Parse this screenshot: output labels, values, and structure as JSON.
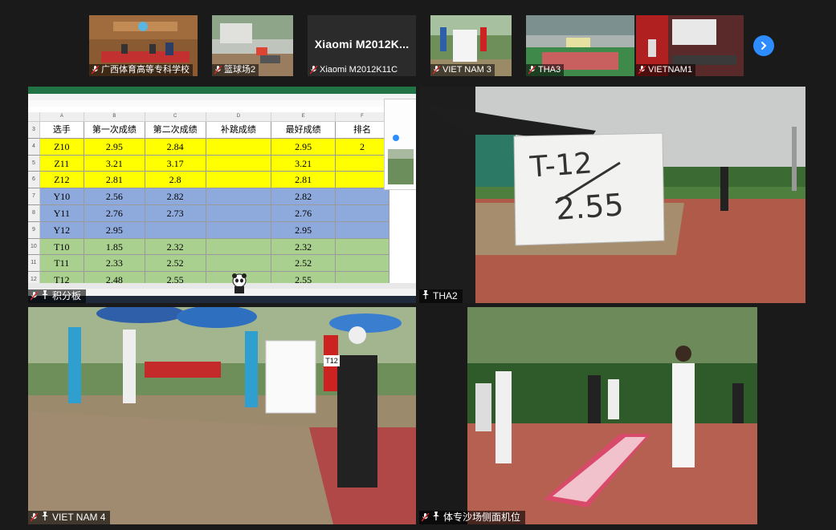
{
  "thumbnails": [
    {
      "label": "广西体育高等专科学校"
    },
    {
      "label": "篮球场2"
    },
    {
      "label": "Xiaomi M2012K11C",
      "name_card": "Xiaomi  M2012K..."
    },
    {
      "label": "VIET NAM 3"
    },
    {
      "label": "THA3"
    },
    {
      "label": "VIETNAM1"
    }
  ],
  "tiles": {
    "scoreboard": {
      "label": "积分板"
    },
    "tha2": {
      "label": "THA2",
      "sign_line1": "T-12",
      "sign_line2": "2.55"
    },
    "vietnam4": {
      "label": "VIET NAM 4",
      "bib": "T12"
    },
    "sandpit": {
      "label": "体专沙场侧面机位"
    }
  },
  "spreadsheet": {
    "col_letters": [
      "A",
      "B",
      "C",
      "D",
      "E",
      "F"
    ],
    "headers": [
      "选手",
      "第一次成绩",
      "第二次成绩",
      "补跳成绩",
      "最好成绩",
      "排名"
    ],
    "rows": [
      {
        "num": "4",
        "cells": [
          "Z10",
          "2.95",
          "2.84",
          "",
          "2.95",
          "2"
        ],
        "color": "#ffff00"
      },
      {
        "num": "5",
        "cells": [
          "Z11",
          "3.21",
          "3.17",
          "",
          "3.21",
          ""
        ],
        "color": "#ffff00"
      },
      {
        "num": "6",
        "cells": [
          "Z12",
          "2.81",
          "2.8",
          "",
          "2.81",
          ""
        ],
        "color": "#ffff00"
      },
      {
        "num": "7",
        "cells": [
          "Y10",
          "2.56",
          "2.82",
          "",
          "2.82",
          ""
        ],
        "color": "#8ea9db"
      },
      {
        "num": "8",
        "cells": [
          "Y11",
          "2.76",
          "2.73",
          "",
          "2.76",
          ""
        ],
        "color": "#8ea9db"
      },
      {
        "num": "9",
        "cells": [
          "Y12",
          "2.95",
          "",
          "",
          "2.95",
          ""
        ],
        "color": "#8ea9db"
      },
      {
        "num": "10",
        "cells": [
          "T10",
          "1.85",
          "2.32",
          "",
          "2.32",
          ""
        ],
        "color": "#a9d08e"
      },
      {
        "num": "11",
        "cells": [
          "T11",
          "2.33",
          "2.52",
          "",
          "2.52",
          ""
        ],
        "color": "#a9d08e"
      },
      {
        "num": "12",
        "cells": [
          "T12",
          "2.48",
          "2.55",
          "",
          "2.55",
          ""
        ],
        "color": "#a9d08e"
      }
    ],
    "header_row_num": "3"
  },
  "icons": {
    "muted_mic": "muted-mic-icon",
    "pin": "pin-icon",
    "next": "chevron-right-icon"
  },
  "colors": {
    "accent_blue": "#2d8cff",
    "muted_red": "#e02828",
    "excel_green": "#217346",
    "background": "#1a1a1a"
  }
}
